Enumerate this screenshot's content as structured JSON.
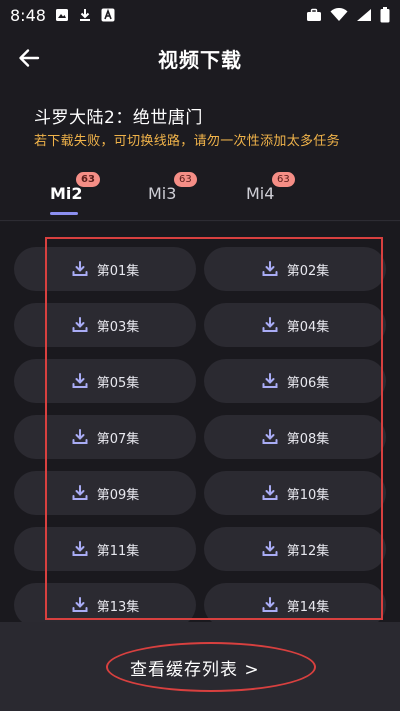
{
  "status_bar": {
    "time": "8:48",
    "left_icons": [
      "image-icon",
      "download-icon",
      "app-a-icon"
    ],
    "right_icons": [
      "briefcase-icon",
      "wifi-icon",
      "signal-icon",
      "battery-icon"
    ]
  },
  "header": {
    "title": "视频下载",
    "back_icon": "back-arrow-icon"
  },
  "show": {
    "title": "斗罗大陆2：绝世唐门",
    "notice": "若下载失败，可切换线路，请勿一次性添加太多任务"
  },
  "tabs": [
    {
      "label": "Mi2",
      "badge": "63",
      "active": true
    },
    {
      "label": "Mi3",
      "badge": "63",
      "active": false
    },
    {
      "label": "Mi4",
      "badge": "63",
      "active": false
    }
  ],
  "episodes": [
    {
      "label": "第01集"
    },
    {
      "label": "第02集"
    },
    {
      "label": "第03集"
    },
    {
      "label": "第04集"
    },
    {
      "label": "第05集"
    },
    {
      "label": "第06集"
    },
    {
      "label": "第07集"
    },
    {
      "label": "第08集"
    },
    {
      "label": "第09集"
    },
    {
      "label": "第10集"
    },
    {
      "label": "第11集"
    },
    {
      "label": "第12集"
    },
    {
      "label": "第13集"
    },
    {
      "label": "第14集"
    }
  ],
  "footer": {
    "cache_link": "查看缓存列表 >"
  },
  "colors": {
    "background": "#1c1b20",
    "button": "#2b2a31",
    "accent": "#8c8ff0",
    "notice": "#f0b34a",
    "badge": "#f58e86",
    "highlight": "#d8403f"
  }
}
